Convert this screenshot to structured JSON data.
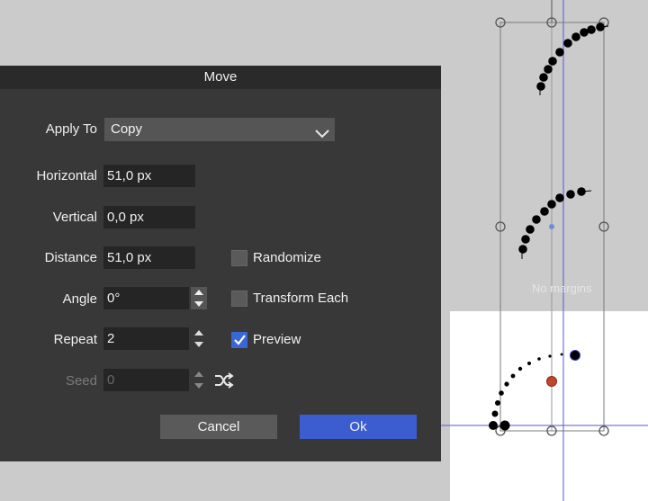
{
  "dialog": {
    "title": "Move",
    "apply_to": {
      "label": "Apply To",
      "value": "Copy"
    },
    "horizontal": {
      "label": "Horizontal",
      "value": "51,0 px"
    },
    "vertical": {
      "label": "Vertical",
      "value": "0,0 px"
    },
    "distance": {
      "label": "Distance",
      "value": "51,0 px"
    },
    "angle": {
      "label": "Angle",
      "value": "0°"
    },
    "repeat": {
      "label": "Repeat",
      "value": "2"
    },
    "seed": {
      "label": "Seed",
      "value": "0"
    },
    "randomize": {
      "label": "Randomize",
      "checked": false
    },
    "transform_each": {
      "label": "Transform Each",
      "checked": false
    },
    "preview": {
      "label": "Preview",
      "checked": true
    },
    "cancel_label": "Cancel",
    "ok_label": "Ok"
  },
  "canvas": {
    "page_label": "No margins"
  },
  "colors": {
    "accent": "#3b5dcf",
    "dialog_bg": "#383838",
    "canvas_bg": "#cbcbcb",
    "selection_guide": "#4a4ad8",
    "origin_dot": "#c0462c"
  }
}
